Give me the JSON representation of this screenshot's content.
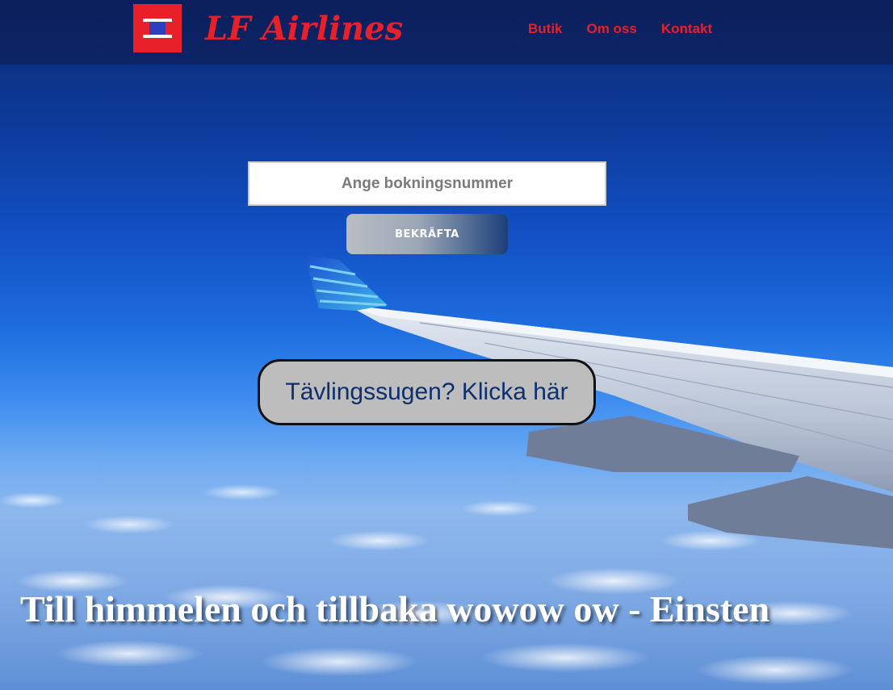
{
  "header": {
    "brand_name": "LF Airlines",
    "logo_icon": "lf-airlines-logo-icon",
    "nav": [
      {
        "label": "Butik"
      },
      {
        "label": "Om oss"
      },
      {
        "label": "Kontakt"
      }
    ]
  },
  "booking": {
    "placeholder": "Ange bokningsnummer",
    "value": "",
    "confirm_label": "BEKRÄFTA"
  },
  "contest": {
    "label": "Tävlingssugen? Klicka här"
  },
  "hero": {
    "tagline": "Till himmelen och tillbaka wowow ow - Einsten",
    "background_icon": "airplane-wing-sky-image"
  },
  "colors": {
    "brand_red": "#e8202a",
    "header_navy": "#0c1f5c",
    "contest_text": "#0d2f6e",
    "contest_bg": "#bdbdbd"
  }
}
